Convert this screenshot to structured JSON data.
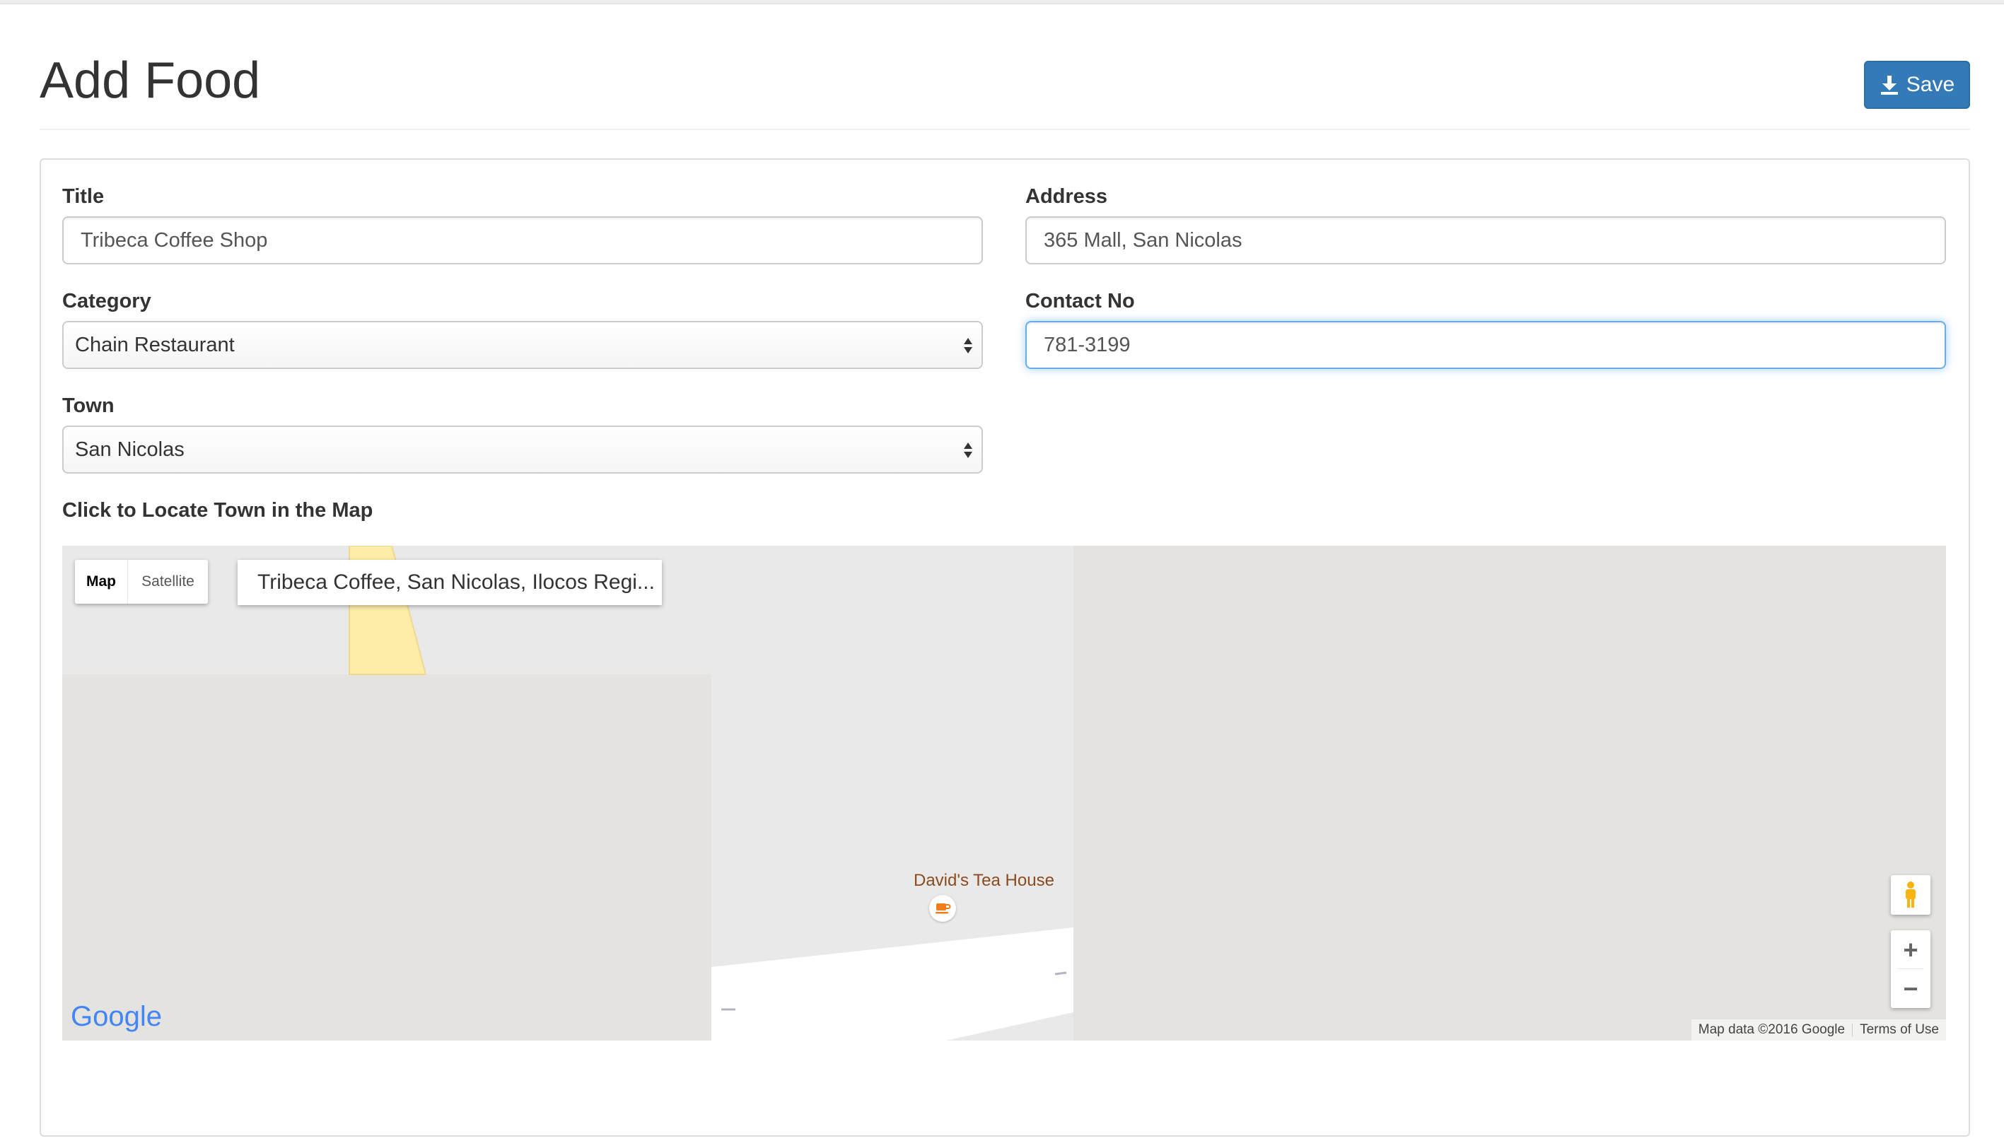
{
  "header": {
    "title": "Add Food",
    "save_label": "Save"
  },
  "form": {
    "title_label": "Title",
    "title_value": "Tribeca Coffee Shop",
    "address_label": "Address",
    "address_value": "365 Mall, San Nicolas",
    "category_label": "Category",
    "category_value": "Chain Restaurant",
    "contact_label": "Contact No",
    "contact_value": "781-3199",
    "town_label": "Town",
    "town_value": "San Nicolas",
    "map_label": "Click to Locate Town in the Map"
  },
  "map": {
    "type_map": "Map",
    "type_satellite": "Satellite",
    "info_text": "Tribeca Coffee, San Nicolas, Ilocos Regi...",
    "poi_name": "David's Tea House",
    "zoom_in": "+",
    "zoom_out": "−",
    "logo": "Google",
    "attribution": "Map data ©2016 Google",
    "terms": "Terms of Use"
  },
  "colors": {
    "primary": "#337ab7",
    "focus": "#66afe9",
    "map_bg": "#e9e9e9",
    "map_block": "#e4e3df",
    "road_yellow": "#fdeda8"
  },
  "icons": {
    "save": "download-icon",
    "select": "updown-arrows-icon",
    "poi": "coffee-cup-icon",
    "street_view": "pegman-icon"
  }
}
